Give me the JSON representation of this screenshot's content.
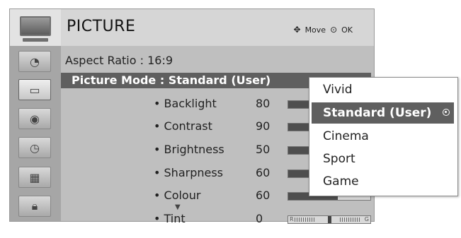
{
  "header": {
    "title": "PICTURE",
    "hint_move_label": "Move",
    "hint_ok_label": "OK",
    "title_icon": "tv-icon"
  },
  "sidebar": {
    "items": [
      {
        "icon": "satellite-dish-icon",
        "active": false
      },
      {
        "icon": "tv-picture-icon",
        "active": true
      },
      {
        "icon": "speaker-icon",
        "active": false
      },
      {
        "icon": "clock-icon",
        "active": false
      },
      {
        "icon": "calendar-icon",
        "active": false
      },
      {
        "icon": "lock-icon",
        "active": false
      }
    ]
  },
  "content": {
    "aspect_ratio": "Aspect Ratio  : 16:9",
    "picture_mode": "Picture Mode : Standard (User)",
    "settings": [
      {
        "label": "• Backlight",
        "value": "80",
        "level": 0.8
      },
      {
        "label": "• Contrast",
        "value": "90",
        "level": 0.9
      },
      {
        "label": "• Brightness",
        "value": "50",
        "level": 0.5
      },
      {
        "label": "• Sharpness",
        "value": "60",
        "level": 0.6
      },
      {
        "label": "• Colour",
        "value": "60",
        "level": 0.6
      },
      {
        "label": "• Tint",
        "value": "0",
        "level": 0.5
      }
    ],
    "tint_left": "R",
    "tint_right": "G"
  },
  "dropdown": {
    "options": [
      {
        "label": "Vivid",
        "selected": false
      },
      {
        "label": "Standard (User)",
        "selected": true
      },
      {
        "label": "Cinema",
        "selected": false
      },
      {
        "label": "Sport",
        "selected": false
      },
      {
        "label": "Game",
        "selected": false
      }
    ]
  },
  "colors": {
    "highlight": "#5f5f5f",
    "panel": "#bfbfbf",
    "sidebar": "#a6a6a6"
  }
}
